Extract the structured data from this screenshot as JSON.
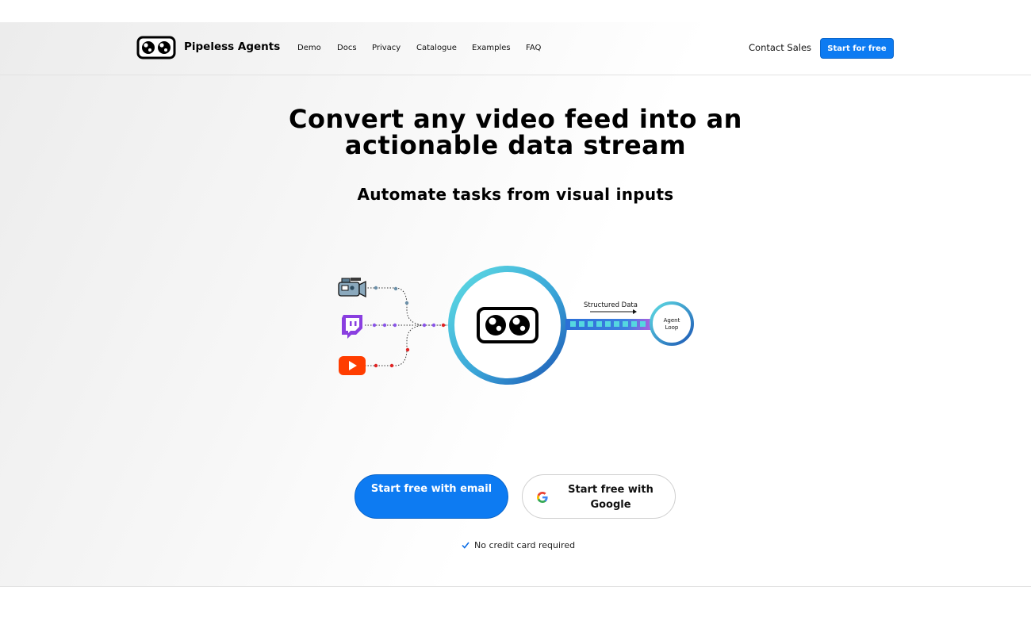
{
  "header": {
    "brand": "Pipeless Agents",
    "nav": [
      "Demo",
      "Docs",
      "Privacy",
      "Catalogue",
      "Examples",
      "FAQ"
    ],
    "contact_label": "Contact Sales",
    "start_label": "Start for free"
  },
  "hero": {
    "title_line1": "Convert any video feed into an",
    "title_line2": "actionable data stream",
    "subtitle": "Automate tasks from visual inputs"
  },
  "diagram": {
    "sources": [
      "video-camera-icon",
      "twitch-icon",
      "youtube-icon"
    ],
    "structured_label": "Structured Data",
    "agent_line1": "Agent",
    "agent_line2": "Loop"
  },
  "cta": {
    "email_label": "Start free with email",
    "google_label": "Start free with Google",
    "note": "No credit card required"
  },
  "colors": {
    "primary": "#0d7bf2",
    "twitch": "#6441a5",
    "youtube": "#ff3d00",
    "ring_start": "#55d7e0",
    "ring_end": "#1f5fb8"
  }
}
